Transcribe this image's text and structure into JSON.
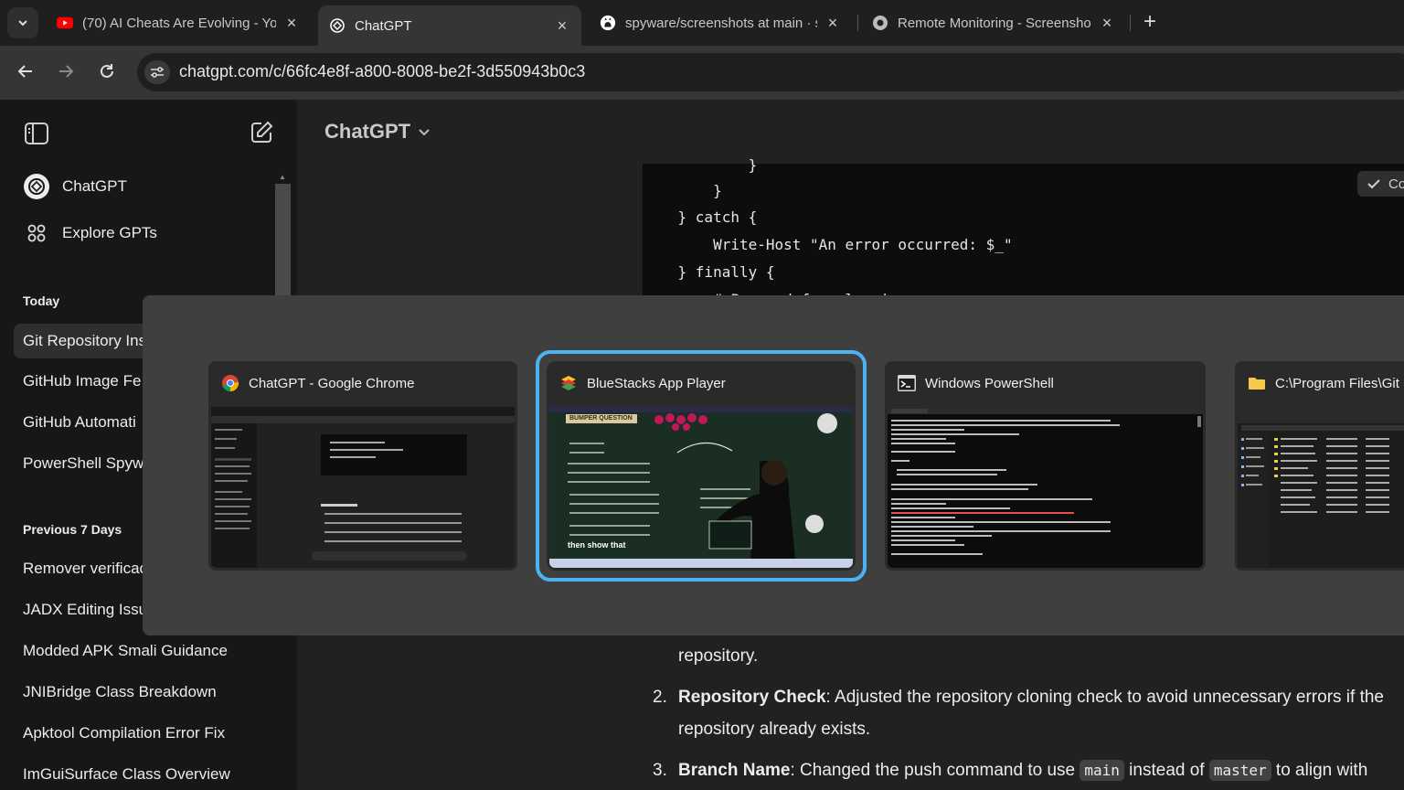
{
  "browser": {
    "tabs": [
      {
        "title": "(70) AI Cheats Are Evolving - Yo",
        "icon": "youtube-icon",
        "active": false
      },
      {
        "title": "ChatGPT",
        "icon": "openai-icon",
        "active": true
      },
      {
        "title": "spyware/screenshots at main · s",
        "icon": "github-icon",
        "active": false
      },
      {
        "title": "Remote Monitoring - Screensho",
        "icon": "globe-icon",
        "active": false
      }
    ],
    "url": "chatgpt.com/c/66fc4e8f-a800-8008-be2f-3d550943b0c3"
  },
  "sidebar": {
    "nav": [
      {
        "label": "ChatGPT",
        "icon": "openai-icon"
      },
      {
        "label": "Explore GPTs",
        "icon": "grid-icon"
      }
    ],
    "today_heading": "Today",
    "today": [
      "Git Repository Ins",
      "GitHub Image Fe",
      "GitHub Automati",
      "PowerShell Spyw"
    ],
    "previous_heading": "Previous 7 Days",
    "previous": [
      "Remover verificac",
      "JADX Editing Issu",
      "Modded APK Smali Guidance",
      "JNIBridge Class Breakdown",
      "Apktool Compilation Error Fix",
      "ImGuiSurface Class Overview"
    ]
  },
  "main": {
    "model_label": "ChatGPT",
    "copy_label": "Co",
    "code_lines": [
      "            }",
      "        }",
      "    } catch {",
      "        Write-Host \"An error occurred: $_\"",
      "    } finally {",
      "        # Proceed for cleanin"
    ],
    "answer": {
      "line0": "repository.",
      "item2_num": "2.",
      "item2_bold": "Repository Check",
      "item2_text": ": Adjusted the repository cloning check to avoid unnecessary errors if the",
      "item2_cont": "repository already exists.",
      "item3_num": "3.",
      "item3_bold": "Branch Name",
      "item3_text_a": ": Changed the push command to use ",
      "item3_code_a": "main",
      "item3_text_b": " instead of ",
      "item3_code_b": "master",
      "item3_text_c": " to align with"
    }
  },
  "task_switcher": {
    "windows": [
      {
        "title": "ChatGPT - Google Chrome",
        "icon": "chrome-icon",
        "selected": false
      },
      {
        "title": "BlueStacks App Player",
        "icon": "bluestacks-icon",
        "selected": true
      },
      {
        "title": "Windows PowerShell",
        "icon": "powershell-icon",
        "selected": false
      },
      {
        "title": "C:\\Program Files\\Git",
        "icon": "folder-icon",
        "selected": false
      }
    ],
    "bluestacks_thumb": {
      "badge": "BUMPER QUESTION",
      "caption": "then show that"
    }
  },
  "colors": {
    "selection_ring": "#4cb3f0",
    "sidebar_bg": "#171717",
    "main_bg": "#212121",
    "switcher_bg": "#3f3f3f"
  }
}
